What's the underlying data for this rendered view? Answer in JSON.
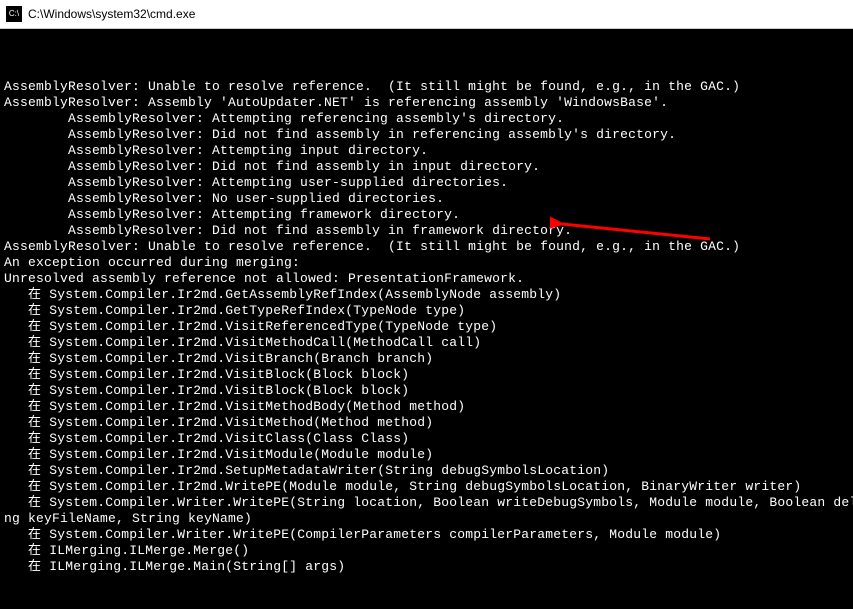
{
  "window": {
    "title": "C:\\Windows\\system32\\cmd.exe",
    "icon_label": "C:\\"
  },
  "console": {
    "lines": [
      "AssemblyResolver: Unable to resolve reference.  (It still might be found, e.g., in the GAC.)",
      "AssemblyResolver: Assembly 'AutoUpdater.NET' is referencing assembly 'WindowsBase'.",
      "        AssemblyResolver: Attempting referencing assembly's directory.",
      "        AssemblyResolver: Did not find assembly in referencing assembly's directory.",
      "        AssemblyResolver: Attempting input directory.",
      "        AssemblyResolver: Did not find assembly in input directory.",
      "        AssemblyResolver: Attempting user-supplied directories.",
      "        AssemblyResolver: No user-supplied directories.",
      "        AssemblyResolver: Attempting framework directory.",
      "        AssemblyResolver: Did not find assembly in framework directory.",
      "AssemblyResolver: Unable to resolve reference.  (It still might be found, e.g., in the GAC.)",
      "An exception occurred during merging:",
      "Unresolved assembly reference not allowed: PresentationFramework.",
      "   在 System.Compiler.Ir2md.GetAssemblyRefIndex(AssemblyNode assembly)",
      "   在 System.Compiler.Ir2md.GetTypeRefIndex(TypeNode type)",
      "   在 System.Compiler.Ir2md.VisitReferencedType(TypeNode type)",
      "   在 System.Compiler.Ir2md.VisitMethodCall(MethodCall call)",
      "   在 System.Compiler.Ir2md.VisitBranch(Branch branch)",
      "   在 System.Compiler.Ir2md.VisitBlock(Block block)",
      "   在 System.Compiler.Ir2md.VisitBlock(Block block)",
      "   在 System.Compiler.Ir2md.VisitMethodBody(Method method)",
      "   在 System.Compiler.Ir2md.VisitMethod(Method method)",
      "   在 System.Compiler.Ir2md.VisitClass(Class Class)",
      "   在 System.Compiler.Ir2md.VisitModule(Module module)",
      "   在 System.Compiler.Ir2md.SetupMetadataWriter(String debugSymbolsLocation)",
      "   在 System.Compiler.Ir2md.WritePE(Module module, String debugSymbolsLocation, BinaryWriter writer)",
      "   在 System.Compiler.Writer.WritePE(String location, Boolean writeDebugSymbols, Module module, Boolean delaySign, String keyFileName, String keyName)",
      "   在 System.Compiler.Writer.WritePE(CompilerParameters compilerParameters, Module module)",
      "   在 ILMerging.ILMerge.Merge()",
      "   在 ILMerging.ILMerge.Main(String[] args)"
    ]
  },
  "annotation": {
    "arrow_target_line": 12
  }
}
